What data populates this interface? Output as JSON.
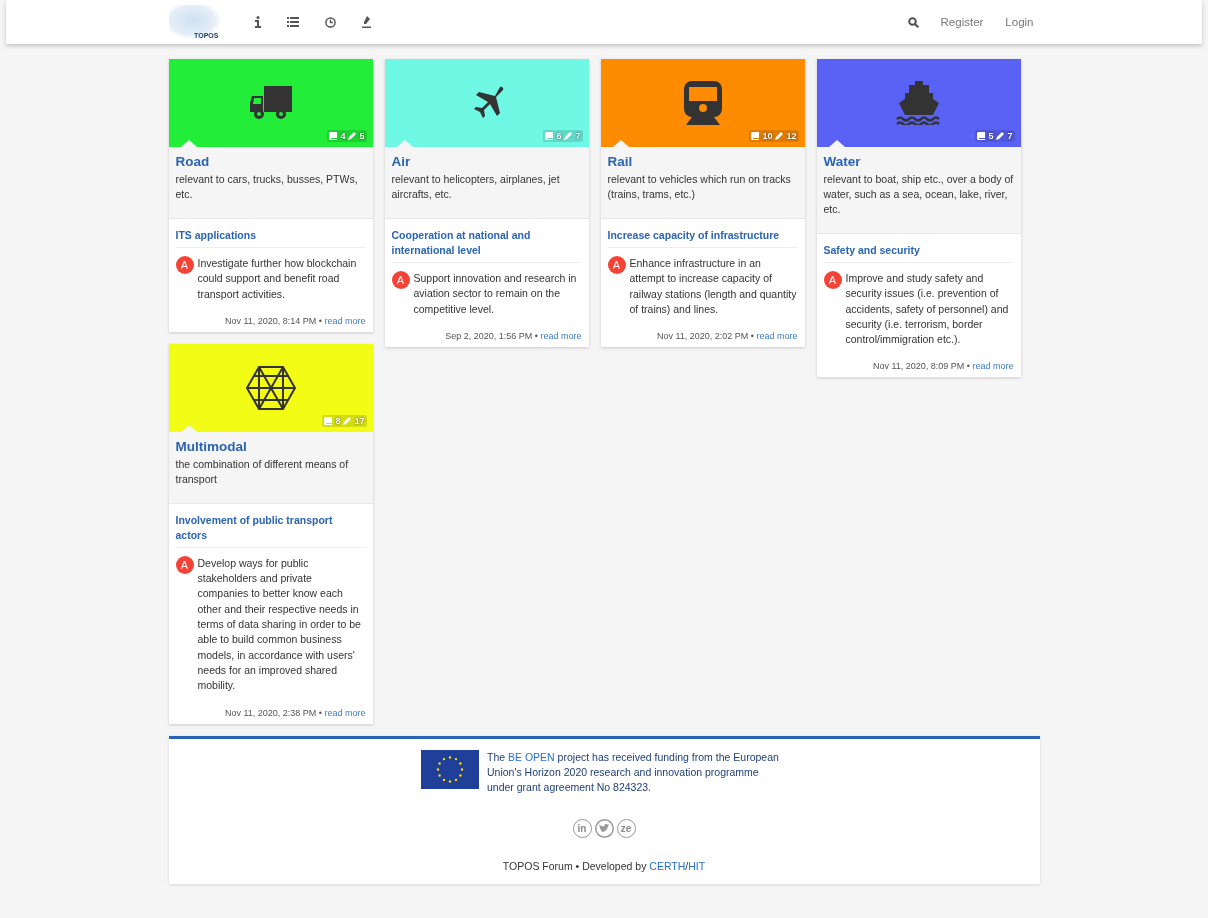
{
  "navbar": {
    "logo_text": "TOPOS",
    "icons": [
      {
        "kind": "info"
      },
      {
        "kind": "list"
      },
      {
        "kind": "clock"
      },
      {
        "kind": "tag"
      }
    ],
    "right": {
      "search": {
        "kind": "search"
      },
      "links": [
        "Register",
        "Login"
      ]
    }
  },
  "categories": [
    {
      "name": "Road",
      "kind": "truck",
      "sep": "•",
      "color": "#22ee3a",
      "topics": "4",
      "posts": "5",
      "description": "relevant to cars, trucks, busses, PTWs, etc.",
      "topic": "ITS applications",
      "avatar": "A",
      "excerpt": "Investigate further how blockchain could support and benefit road transport activities.",
      "timestamp": "Nov 11, 2020, 8:14 PM",
      "more": "read more"
    },
    {
      "name": "Air",
      "kind": "plane",
      "sep": "•",
      "color": "#6ff8e4",
      "topics": "6",
      "posts": "7",
      "description": "relevant to helicopters, airplanes, jet aircrafts, etc.",
      "topic": "Cooperation at national and international level",
      "avatar": "A",
      "excerpt": "Support innovation and research in aviation sector to remain on the competitive level.",
      "timestamp": "Sep 2, 2020, 1:56 PM",
      "more": "read more"
    },
    {
      "name": "Rail",
      "kind": "train",
      "sep": "•",
      "color": "#ff8c00",
      "topics": "10",
      "posts": "12",
      "description": "relevant to vehicles which run on tracks (trains, trams, etc.)",
      "topic": "Increase capacity of infrastructure",
      "avatar": "A",
      "excerpt": "Enhance infrastructure in an attempt to increase capacity of railway stations (length and quantity of trains) and lines.",
      "timestamp": "Nov 11, 2020, 2:02 PM",
      "more": "read more"
    },
    {
      "name": "Water",
      "kind": "ship",
      "sep": "•",
      "color": "#5a62f5",
      "topics": "5",
      "posts": "7",
      "description": "relevant to boat, ship etc., over a body of water, such as a sea, ocean, lake, river, etc.",
      "topic": "Safety and security",
      "avatar": "A",
      "excerpt": "Improve and study safety and security issues (i.e. prevention of accidents, safety of personnel) and security (i.e. terrorism, border control/immigration etc.).",
      "timestamp": "Nov 11, 2020, 8:09 PM",
      "more": "read more"
    },
    {
      "name": "Multimodal",
      "kind": "hexagon",
      "sep": "•",
      "color": "#f2fc14",
      "topics": "8",
      "posts": "17",
      "description": "the combination of different means of transport",
      "topic": "Involvement of public transport actors",
      "avatar": "A",
      "excerpt": "Develop ways for public stakeholders and private companies to better know each other and their respective needs in terms of data sharing in order to be able to build common business models, in accordance with users' needs for an improved shared mobility.",
      "timestamp": "Nov 11, 2020, 2:38 PM",
      "more": "read more"
    }
  ],
  "footer": {
    "funding": {
      "before": "The ",
      "link": "BE OPEN",
      "after": " project has received funding from the European Union's Horizon 2020 research and innovation programme under grant agreement No 824323."
    },
    "social": [
      {
        "kind": "linkedin",
        "label": "in"
      },
      {
        "kind": "twitter"
      },
      {
        "kind": "zenodo",
        "label": "ze"
      }
    ],
    "credits": {
      "text": "TOPOS Forum • Developed by ",
      "links": [
        "CERTH",
        "HIT"
      ],
      "separator": "/"
    }
  }
}
